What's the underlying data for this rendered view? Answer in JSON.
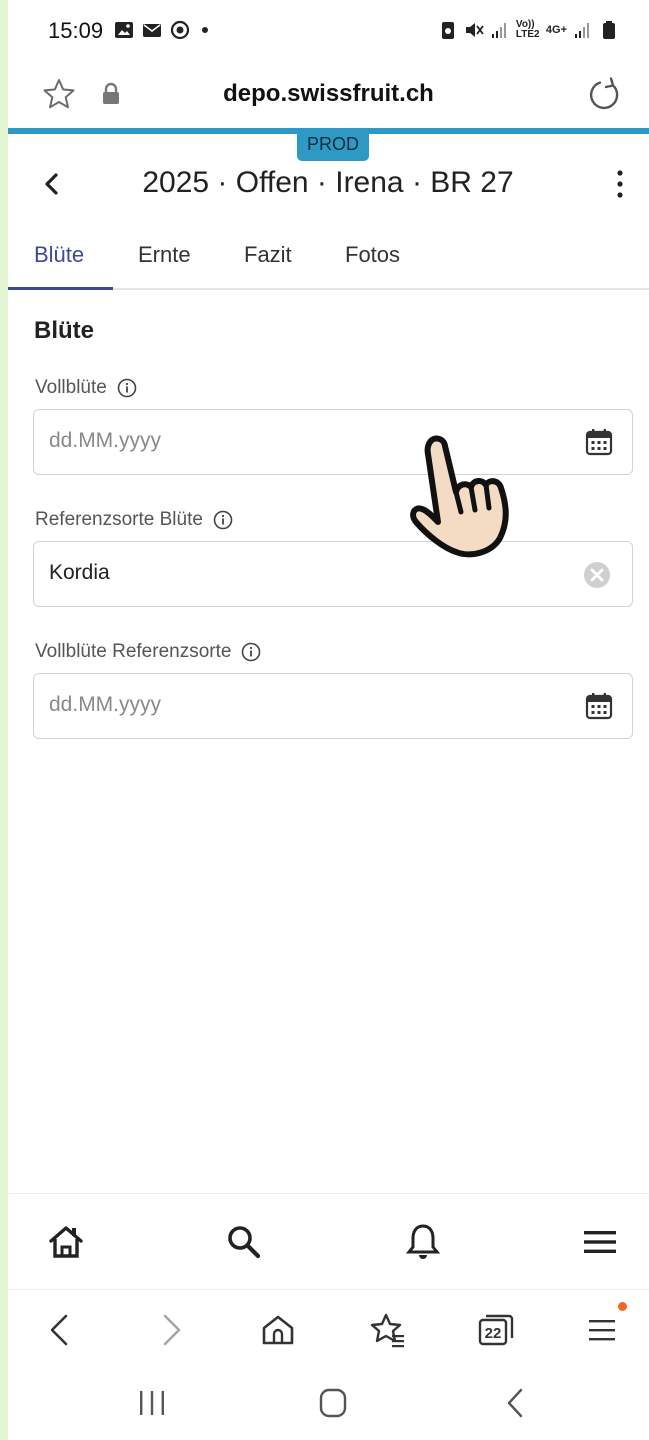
{
  "status_bar": {
    "time": "15:09",
    "left_icons": [
      "gallery-icon",
      "mail-icon",
      "sync-icon",
      "more-dot"
    ],
    "right_icons": [
      "battery-saver-icon",
      "mute-icon",
      "signal-icon",
      "volte-icon",
      "network-4g-icon",
      "signal-icon",
      "battery-icon"
    ],
    "volte_label": "Vo)) LTE2",
    "network_label": "4G+"
  },
  "browser": {
    "url": "depo.swissfruit.ch",
    "accent_color": "#2e9ac4"
  },
  "environment_badge": "PROD",
  "header": {
    "title": "2025 · Offen · Irena · BR 27"
  },
  "tabs": [
    {
      "label": "Blüte",
      "active": true
    },
    {
      "label": "Ernte",
      "active": false
    },
    {
      "label": "Fazit",
      "active": false
    },
    {
      "label": "Fotos",
      "active": false
    }
  ],
  "section": {
    "title": "Blüte"
  },
  "fields": {
    "vollbluete": {
      "label": "Vollblüte",
      "value": "",
      "placeholder": "dd.MM.yyyy"
    },
    "referenzsorte": {
      "label": "Referenzsorte Blüte",
      "value": "Kordia"
    },
    "vollbluete_ref": {
      "label": "Vollblüte Referenzsorte",
      "value": "",
      "placeholder": "dd.MM.yyyy"
    }
  },
  "app_nav": [
    "home-icon",
    "search-icon",
    "bell-icon",
    "menu-icon"
  ],
  "browser_toolbar": {
    "tab_count": "22",
    "items": [
      "back-icon",
      "forward-icon",
      "home-icon",
      "bookmarks-icon",
      "tabs-icon",
      "menu-icon"
    ]
  },
  "colors": {
    "active_tab": "#3b4a99",
    "badge": "#2e9ac4",
    "notification_dot": "#f26522"
  }
}
